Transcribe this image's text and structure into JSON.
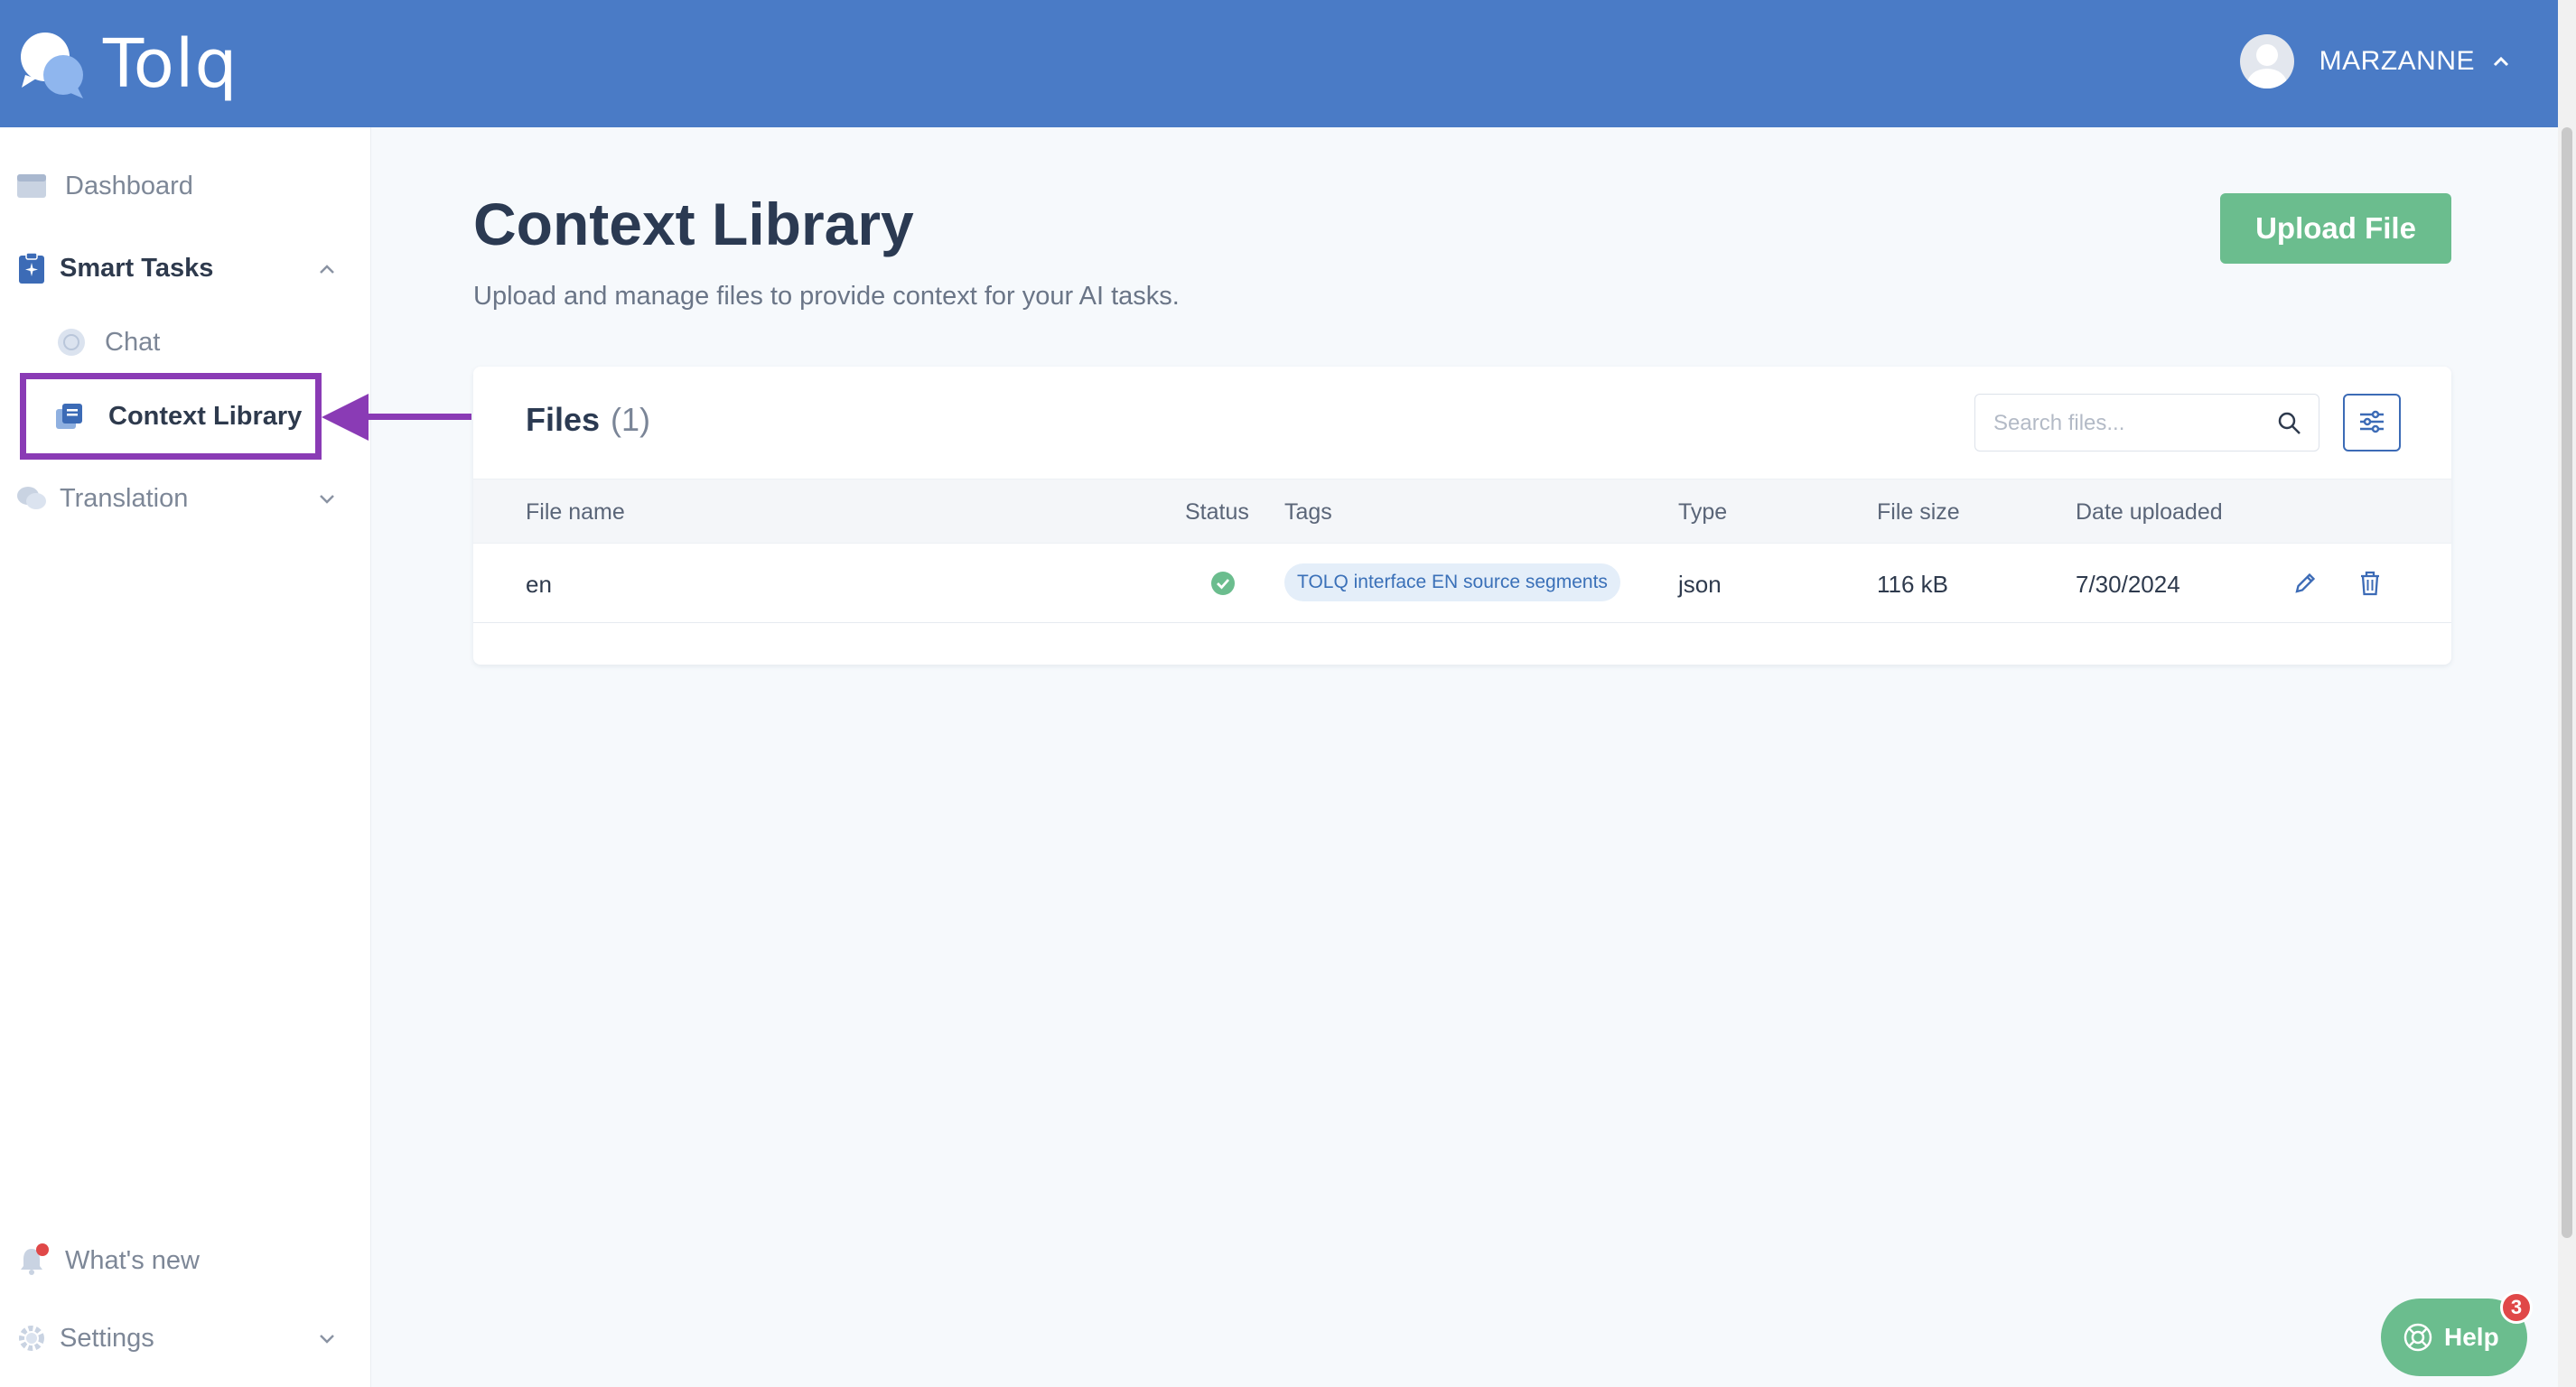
{
  "header": {
    "logo_text": "Tolq",
    "user_name": "MARZANNE"
  },
  "sidebar": {
    "dashboard": "Dashboard",
    "smart_tasks": "Smart Tasks",
    "chat": "Chat",
    "context_library": "Context Library",
    "translation": "Translation",
    "whats_new": "What's new",
    "settings": "Settings"
  },
  "main": {
    "title": "Context Library",
    "subtitle": "Upload and manage files to provide context for your AI tasks.",
    "upload_label": "Upload File"
  },
  "files": {
    "title": "Files",
    "count": "(1)",
    "search_placeholder": "Search files...",
    "columns": [
      "File name",
      "Status",
      "Tags",
      "Type",
      "File size",
      "Date uploaded"
    ],
    "rows": [
      {
        "name": "en",
        "status": "success",
        "tag": "TOLQ interface EN source segments",
        "type": "json",
        "size": "116 kB",
        "date": "7/30/2024"
      }
    ]
  },
  "help": {
    "label": "Help",
    "badge": "3"
  },
  "colors": {
    "header": "#4a7bc6",
    "accent_green": "#6bbd8e",
    "highlight_purple": "#8a3bb5",
    "badge_red": "#e04848"
  }
}
